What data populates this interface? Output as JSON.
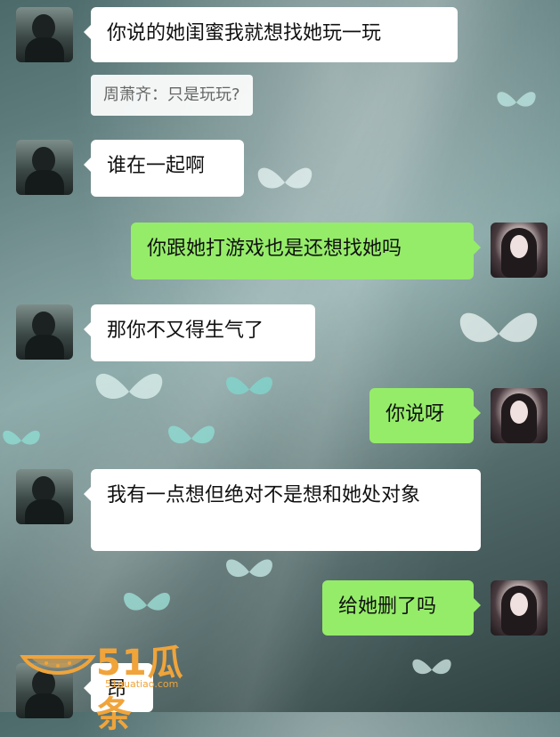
{
  "chat": {
    "messages": [
      {
        "side": "left",
        "text": "你说的她闺蜜我就想找她玩一玩"
      },
      {
        "side": "left",
        "text": "谁在一起啊"
      },
      {
        "side": "right",
        "text": "你跟她打游戏也是还想找她吗"
      },
      {
        "side": "left",
        "text": "那你不又得生气了"
      },
      {
        "side": "right",
        "text": "你说呀"
      },
      {
        "side": "left",
        "text": "我有一点想但绝对不是想和她处对象"
      },
      {
        "side": "right",
        "text": "给她删了吗"
      },
      {
        "side": "left",
        "text": "昂"
      }
    ],
    "quote": "周萧齐：只是玩玩?"
  },
  "watermark": {
    "brand": "51瓜条",
    "url": "51guatiao.com"
  },
  "colors": {
    "bubble_left": "#ffffff",
    "bubble_right": "#95ec69",
    "watermark": "#f0a43a"
  }
}
